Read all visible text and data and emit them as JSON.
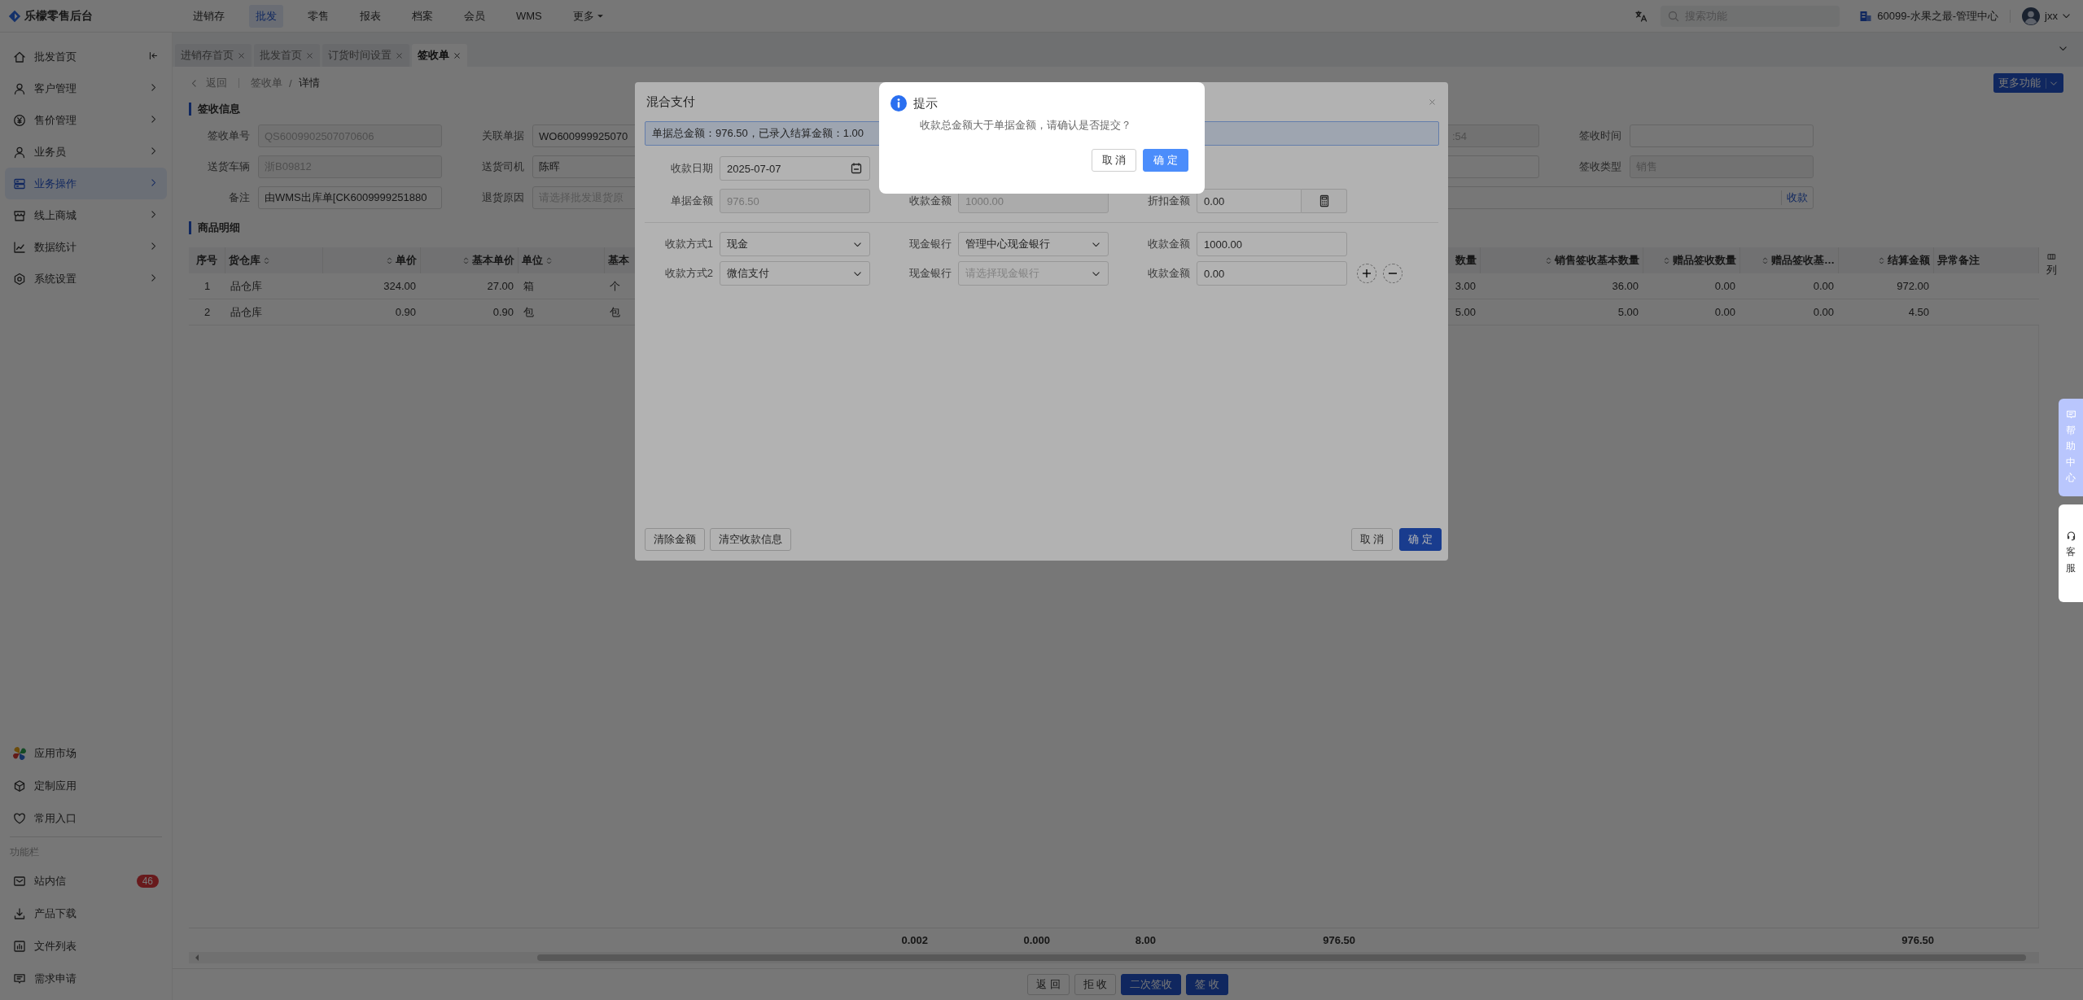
{
  "header": {
    "logo": "乐檬零售后台",
    "nav": [
      {
        "label": "进销存",
        "selected": false,
        "dropdown": false
      },
      {
        "label": "批发",
        "selected": true,
        "dropdown": false
      },
      {
        "label": "零售",
        "selected": false,
        "dropdown": false
      },
      {
        "label": "报表",
        "selected": false,
        "dropdown": false
      },
      {
        "label": "档案",
        "selected": false,
        "dropdown": false
      },
      {
        "label": "会员",
        "selected": false,
        "dropdown": false
      },
      {
        "label": "WMS",
        "selected": false,
        "dropdown": false
      },
      {
        "label": "更多",
        "selected": false,
        "dropdown": true
      }
    ],
    "search": {
      "placeholder": "搜索功能"
    },
    "store": "60099-水果之最-管理中心",
    "user": "jxx"
  },
  "sidebar": {
    "items": [
      {
        "label": "批发首页",
        "selected": false,
        "expandable": false
      },
      {
        "label": "客户管理",
        "selected": false,
        "expandable": true
      },
      {
        "label": "售价管理",
        "selected": false,
        "expandable": true
      },
      {
        "label": "业务员",
        "selected": false,
        "expandable": true
      },
      {
        "label": "业务操作",
        "selected": true,
        "expandable": true
      },
      {
        "label": "线上商城",
        "selected": false,
        "expandable": true
      },
      {
        "label": "数据统计",
        "selected": false,
        "expandable": true
      },
      {
        "label": "系统设置",
        "selected": false,
        "expandable": true
      }
    ],
    "apps": [
      {
        "label": "应用市场"
      },
      {
        "label": "定制应用"
      },
      {
        "label": "常用入口"
      }
    ],
    "section_title": "功能栏",
    "tools": [
      {
        "label": "站内信",
        "badge": "46"
      },
      {
        "label": "产品下载"
      },
      {
        "label": "文件列表"
      },
      {
        "label": "需求申请"
      }
    ]
  },
  "tabs": [
    {
      "label": "进销存首页",
      "selected": false
    },
    {
      "label": "批发首页",
      "selected": false
    },
    {
      "label": "订货时间设置",
      "selected": false
    },
    {
      "label": "签收单",
      "selected": true
    }
  ],
  "breadcrumb": {
    "back": "返回",
    "path": [
      "签收单",
      "详情"
    ],
    "separator": "/"
  },
  "more_button": {
    "label": "更多功能"
  },
  "sign_info": {
    "title": "签收信息",
    "fields": [
      {
        "kind": "field",
        "label": "签收单号",
        "value": "QS6009902507070606",
        "disabled": true
      },
      {
        "kind": "field",
        "label": "关联单据",
        "value": "WO600999925070",
        "disabled": false
      },
      {
        "kind": "tail",
        "value": ":54",
        "disabled": true
      },
      {
        "kind": "field",
        "label": "签收时间"
      },
      {
        "kind": "field",
        "label": "送货车辆",
        "value": "浙B09812",
        "disabled": true
      },
      {
        "kind": "field",
        "label": "送货司机",
        "value": "陈晖",
        "disabled": false
      },
      {
        "kind": "tail"
      },
      {
        "kind": "field",
        "label": "签收类型",
        "value": "销售",
        "disabled": true
      },
      {
        "kind": "field",
        "label": "备注",
        "value": "由WMS出库单[CK6009999251880",
        "disabled": false
      },
      {
        "kind": "field",
        "label": "退货原因",
        "placeholder": "请选择批发退货原"
      },
      {
        "kind": "wide",
        "link": "收款"
      }
    ]
  },
  "goods": {
    "title": "商品明细",
    "columns": [
      {
        "label": "序号",
        "sortable": false,
        "numeric": false
      },
      {
        "label": "货仓库",
        "sortable": true,
        "numeric": false
      },
      {
        "label": "单价",
        "sortable": true,
        "numeric": true
      },
      {
        "label": "基本单价",
        "sortable": true,
        "numeric": true
      },
      {
        "label": "单位",
        "sortable": true,
        "numeric": false
      },
      {
        "label": "基本",
        "numeric": false
      },
      {
        "label": "数量",
        "sortable": false,
        "numeric": true
      },
      {
        "label": "销售签收基本数量",
        "sortable": true,
        "numeric": true
      },
      {
        "label": "赠品签收数量",
        "sortable": true,
        "numeric": true
      },
      {
        "label": "赠品签收基…",
        "sortable": true,
        "numeric": true
      },
      {
        "label": "结算金额",
        "sortable": true,
        "numeric": true
      },
      {
        "label": "异常备注",
        "sortable": false,
        "numeric": false
      }
    ],
    "rows": [
      [
        "1",
        "品仓库",
        "324.00",
        "27.00",
        "箱",
        "个",
        "3.00",
        "36.00",
        "0.00",
        "0.00",
        "972.00"
      ],
      [
        "2",
        "品仓库",
        "0.90",
        "0.90",
        "包",
        "包",
        "5.00",
        "5.00",
        "0.00",
        "0.00",
        "4.50"
      ]
    ],
    "totals": [
      "0.002",
      "0.000",
      "8.00",
      "976.50",
      "976.50"
    ],
    "column_settings": "列"
  },
  "actions": [
    {
      "label": "返 回",
      "kind": "default"
    },
    {
      "label": "拒 收",
      "kind": "default"
    },
    {
      "label": "二次签收",
      "kind": "primary"
    },
    {
      "label": "签 收",
      "kind": "primary"
    }
  ],
  "help": [
    {
      "label": "帮助中心",
      "kind": "help"
    },
    {
      "label": "客服",
      "kind": "service"
    }
  ],
  "mixed_payment": {
    "title": "混合支付",
    "summary": "单据总金额：976.50，已录入结算金额：1.00",
    "fields": [
      [
        {
          "kind": "date",
          "label": "收款日期",
          "value": "2025-07-07",
          "disabled": false
        }
      ],
      [
        {
          "kind": "text",
          "label": "单据金额",
          "value": "976.50",
          "disabled": true
        },
        {
          "kind": "text",
          "label": "收款金额",
          "value": "1000.00",
          "disabled": true
        },
        {
          "kind": "calc",
          "label": "折扣金额",
          "value": "0.00",
          "disabled": false
        }
      ]
    ],
    "payments": [
      {
        "method_label": "收款方式1",
        "method": "现金",
        "bank_label": "现金银行",
        "bank": "管理中心现金银行",
        "amount_label": "收款金额",
        "amount": "1000.00"
      },
      {
        "method_label": "收款方式2",
        "method": "微信支付",
        "bank_label": "现金银行",
        "bank_placeholder": "请选择现金银行",
        "amount_label": "收款金额",
        "amount": "0.00"
      }
    ],
    "left_buttons": [
      "清除金额",
      "清空收款信息"
    ],
    "right_buttons": [
      {
        "label": "取 消",
        "kind": "default"
      },
      {
        "label": "确 定",
        "kind": "primary"
      }
    ]
  },
  "alert": {
    "title": "提示",
    "message": "收款总金额大于单据金额，请确认是否提交？",
    "buttons": [
      {
        "label": "取 消",
        "kind": "default"
      },
      {
        "label": "确 定",
        "kind": "primary"
      }
    ]
  }
}
